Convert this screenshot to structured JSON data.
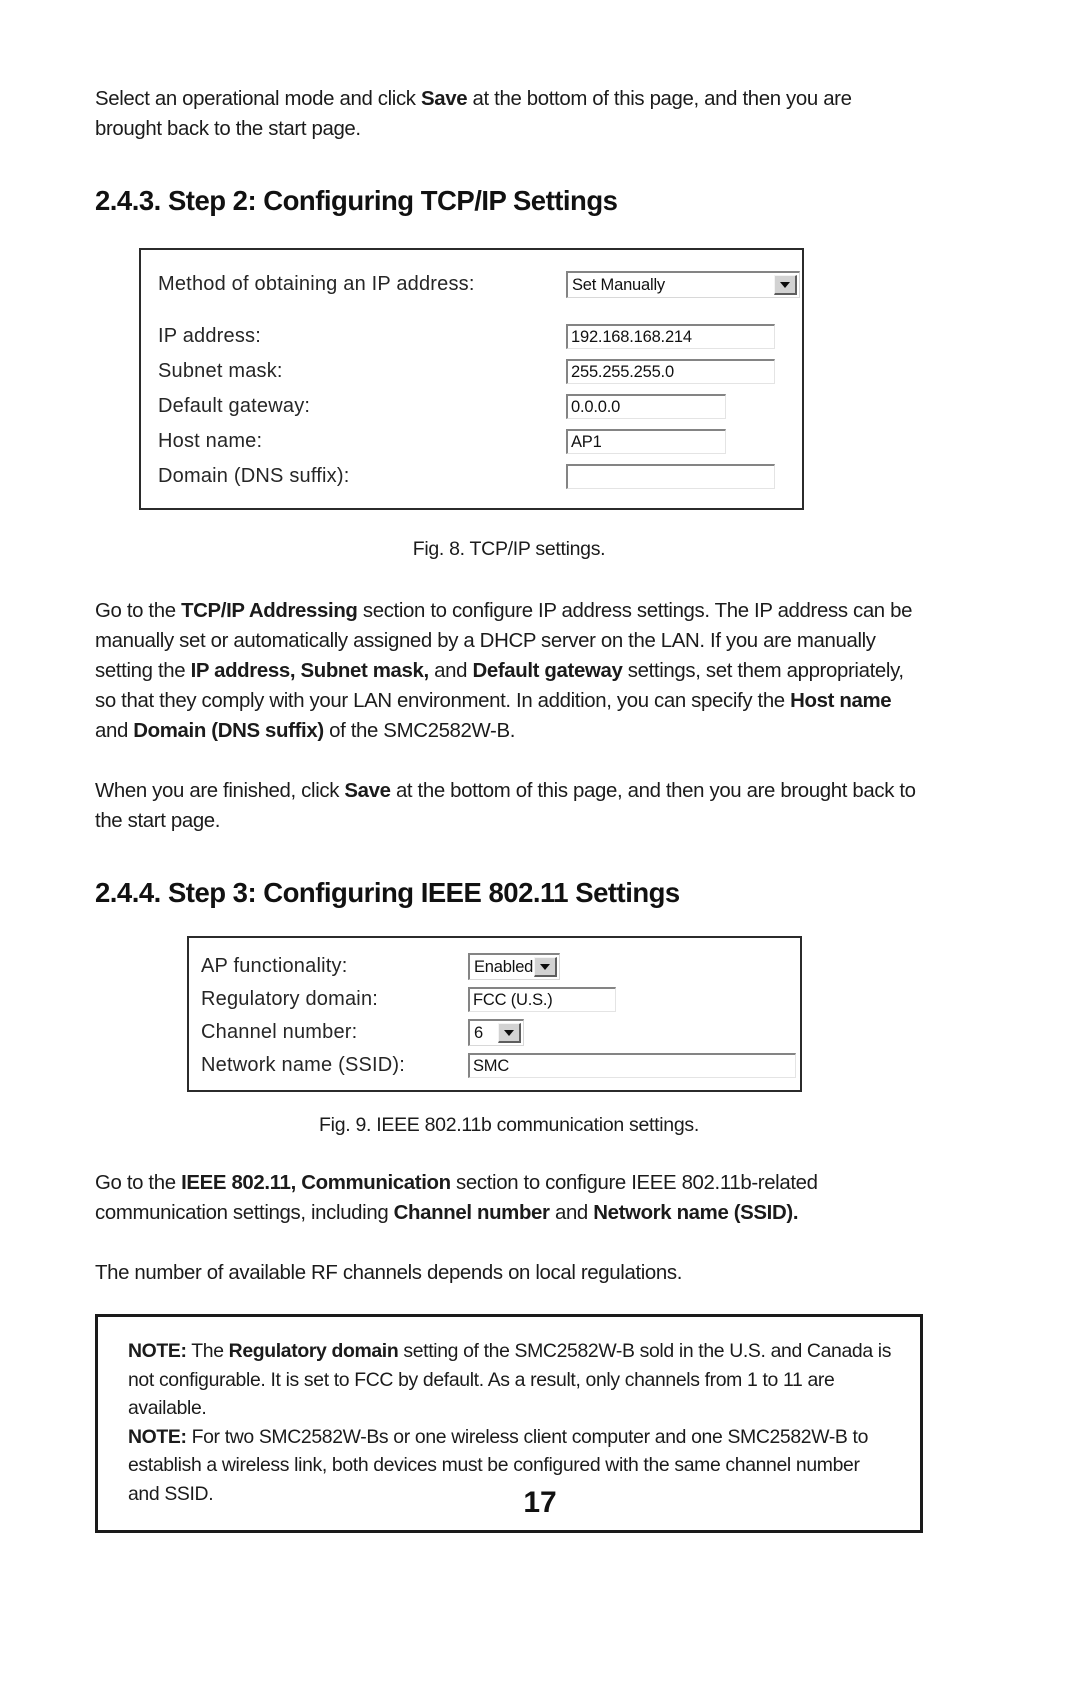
{
  "page": {
    "number": "17"
  },
  "intro_paragraph": {
    "before_bold": "Select an operational mode and click ",
    "bold": "Save",
    "after_bold": " at the bottom of this page, and then you are brought back to the start page."
  },
  "section_243": {
    "heading": "2.4.3. Step 2: Configuring TCP/IP Settings",
    "figure": {
      "caption": "Fig. 8. TCP/IP settings.",
      "rows": [
        {
          "label": "Method of obtaining an IP address:",
          "value": "Set Manually",
          "control": "dropdown"
        },
        {
          "label": "IP address:",
          "value": "192.168.168.214",
          "control": "textbox"
        },
        {
          "label": "Subnet mask:",
          "value": "255.255.255.0",
          "control": "textbox"
        },
        {
          "label": "Default gateway:",
          "value": "0.0.0.0",
          "control": "textbox"
        },
        {
          "label": "Host name:",
          "value": "AP1",
          "control": "textbox"
        },
        {
          "label": "Domain (DNS suffix):",
          "value": "",
          "control": "textbox"
        }
      ]
    },
    "body": {
      "run1": "Go to the ",
      "run2_bold": "TCP/IP Addressing",
      "run3": " section to configure IP address settings. The IP address can be manually set or automatically assigned by a DHCP server on the LAN. If you are manually setting the ",
      "run4_bold": "IP address, Subnet mask,",
      "run5": " and ",
      "run6_bold": "Default gateway",
      "run7": " settings, set them appropriately, so that they comply with your LAN environment. In addition, you can specify the ",
      "run8_bold": "Host name",
      "run9": " and ",
      "run10_bold": "Domain (DNS suffix)",
      "run11": " of the SMC2582W-B."
    },
    "closing": {
      "before_bold": "When you are finished, click ",
      "bold": "Save",
      "after_bold": " at the bottom of this page, and then you are brought back to the start page."
    }
  },
  "section_244": {
    "heading": "2.4.4. Step 3: Configuring IEEE 802.11 Settings",
    "figure": {
      "caption": "Fig. 9. IEEE 802.11b communication settings.",
      "rows": [
        {
          "label": "AP functionality:",
          "value": "Enabled",
          "control": "dropdown"
        },
        {
          "label": "Regulatory domain:",
          "value": "FCC (U.S.)",
          "control": "textbox"
        },
        {
          "label": "Channel number:",
          "value": "6",
          "control": "dropdown"
        },
        {
          "label": "Network name (SSID):",
          "value": "SMC",
          "control": "textbox"
        }
      ]
    },
    "body": {
      "run1": "Go to the ",
      "run2_bold": "IEEE 802.11, Communication",
      "run3": " section to configure IEEE 802.11b-related communication settings, including ",
      "run4_bold": "Channel number",
      "run5": " and ",
      "run6_bold": "Network name (SSID)."
    },
    "rf_note": "The number of available RF channels depends on local regulations."
  },
  "note_box": {
    "note1": {
      "label": "NOTE:",
      "run1": " The ",
      "run2_bold": "Regulatory domain",
      "run3": " setting of the SMC2582W-B sold in the U.S. and Canada is not configurable. It is set to FCC by default. As a result, only channels from 1 to 11 are available."
    },
    "note2": {
      "label": "NOTE:",
      "run1": " For two SMC2582W-Bs or one wireless client computer and one SMC2582W-B to establish a wireless link, both devices must be configured with the same channel number and SSID."
    }
  }
}
